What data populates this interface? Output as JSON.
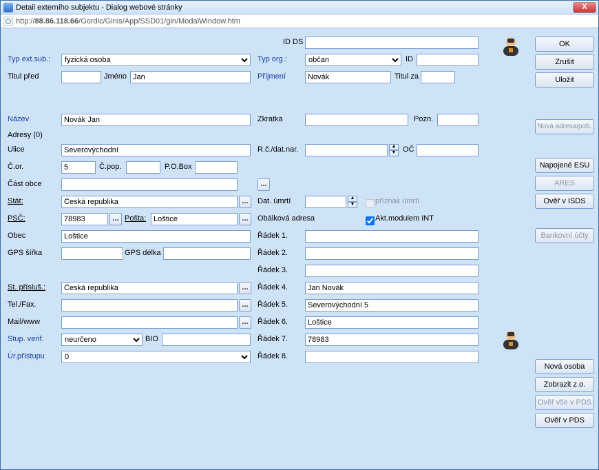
{
  "window": {
    "title": "Detail externího subjektu - Dialog webové stránky",
    "url_prefix": "http://",
    "url_host": "88.86.118.66",
    "url_path": "/Gordic/Ginis/App/SSD01/gin/ModalWindow.htm",
    "close": "X"
  },
  "labels": {
    "id_ds": "ID DS",
    "typ_ext_sub": "Typ ext.sub.:",
    "typ_org": "Typ org.:",
    "id": "ID",
    "titul_pred": "Titul před",
    "jmeno": "Jméno",
    "prijmeni": "Příjmení",
    "titul_za": "Titul za",
    "nazev": "Název",
    "zkratka": "Zkratka",
    "pozn": "Pozn.",
    "adresy": "Adresy (0)",
    "ulice": "Ulice",
    "rc": "R.č./dat.nar.",
    "oc": "OČ",
    "cor": "Č.or.",
    "cpop": "Č.pop.",
    "pobox": "P.O.Box",
    "cast_obce": "Část obce",
    "stat": "Stát:",
    "dat_umrti": "Dat. úmrtí",
    "priznak_umrti": "příznak úmrtí",
    "psc": "PSČ:",
    "posta": "Pošta:",
    "obalkova": "Obálková adresa",
    "akt_modul": "Akt.modulem INT",
    "obec": "Obec",
    "gps_sirka": "GPS šířka",
    "gps_delka": "GPS délka",
    "st_prislus": "St. přísluš.:",
    "tel_fax": "Tel./Fax.",
    "mail": "Mail/www",
    "stup_verif": "Stup. verif.",
    "bio": "BIO",
    "ur_pristupu": "Úr.přístupu",
    "radek": [
      "Řádek 1.",
      "Řádek 2.",
      "Řádek 3.",
      "Řádek 4.",
      "Řádek 5.",
      "Řádek 6.",
      "Řádek 7.",
      "Řádek 8."
    ]
  },
  "values": {
    "id_ds": "",
    "typ_ext_sub": "fyzická osoba",
    "typ_org": "občan",
    "id": "",
    "titul_pred": "",
    "jmeno": "Jan",
    "prijmeni": "Novák",
    "titul_za": "",
    "nazev": "Novák Jan",
    "zkratka": "",
    "pozn": "",
    "ulice": "Severovýchodní",
    "rc": "",
    "oc": "",
    "cor": "5",
    "cpop": "",
    "pobox": "",
    "cast_obce": "",
    "stat": "Česká republika",
    "dat_umrti": "",
    "priznak_umrti": false,
    "psc": "78983",
    "posta": "Loštice",
    "akt_modul": true,
    "obec": "Loštice",
    "gps_sirka": "",
    "gps_delka": "",
    "st_prislus": "Česká republika",
    "tel_fax": "",
    "mail": "",
    "stup_verif": "neurčeno",
    "bio": "",
    "ur_pristupu": "0",
    "radky": [
      "",
      "",
      "",
      "Jan Novák",
      "Severovýchodní 5",
      "Loštice",
      "78983",
      ""
    ]
  },
  "buttons": {
    "ok": "OK",
    "zrusit": "Zrušit",
    "ulozit": "Uložit",
    "nova_adresa": "Nová adresa/pob.",
    "napojene_esu": "Napojené ESU",
    "ares": "ARES",
    "over_isds": "Ověř v ISDS",
    "bankovni_ucty": "Bankovní účty",
    "nova_osoba": "Nová osoba",
    "zobrazit_zo": "Zobrazit z.o.",
    "over_vse_pds": "Ověř vše v PDS",
    "over_pds": "Ověř v PDS",
    "dots": "..."
  }
}
